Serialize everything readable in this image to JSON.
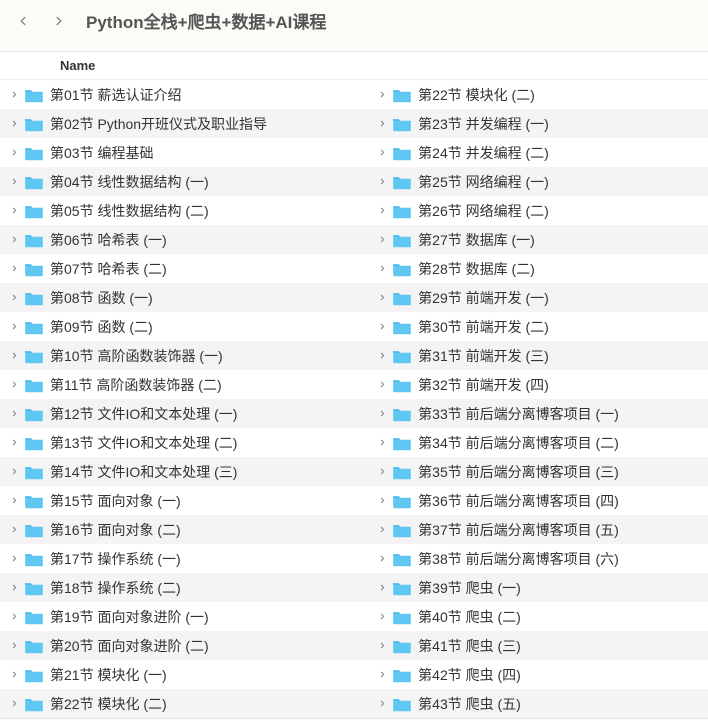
{
  "header": {
    "title": "Python全栈+爬虫+数据+AI课程"
  },
  "column_header": "Name",
  "left_items": [
    "第01节 薪选认证介绍",
    "第02节 Python开班仪式及职业指导",
    "第03节 编程基础",
    "第04节 线性数据结构 (一)",
    "第05节 线性数据结构 (二)",
    "第06节 哈希表 (一)",
    "第07节 哈希表 (二)",
    "第08节 函数 (一)",
    "第09节 函数 (二)",
    "第10节 高阶函数装饰器 (一)",
    "第11节 高阶函数装饰器 (二)",
    "第12节 文件IO和文本处理 (一)",
    "第13节 文件IO和文本处理 (二)",
    "第14节 文件IO和文本处理 (三)",
    "第15节 面向对象 (一)",
    "第16节 面向对象 (二)",
    "第17节 操作系统 (一)",
    "第18节 操作系统 (二)",
    "第19节 面向对象进阶 (一)",
    "第20节 面向对象进阶 (二)",
    "第21节 模块化 (一)",
    "第22节 模块化 (二)"
  ],
  "right_items": [
    "第22节 模块化 (二)",
    "第23节 并发编程 (一)",
    "第24节 并发编程 (二)",
    "第25节 网络编程 (一)",
    "第26节 网络编程 (二)",
    "第27节 数据库 (一)",
    "第28节 数据库 (二)",
    "第29节 前端开发 (一)",
    "第30节 前端开发 (二)",
    "第31节 前端开发 (三)",
    "第32节 前端开发 (四)",
    "第33节 前后端分离博客项目 (一)",
    "第34节 前后端分离博客项目 (二)",
    "第35节 前后端分离博客项目 (三)",
    "第36节 前后端分离博客项目 (四)",
    "第37节 前后端分离博客项目 (五)",
    "第38节 前后端分离博客项目 (六)",
    "第39节 爬虫 (一)",
    "第40节 爬虫 (二)",
    "第41节 爬虫 (三)",
    "第42节 爬虫 (四)",
    "第43节 爬虫 (五)"
  ],
  "colors": {
    "folder_fill": "#5ec8f2",
    "folder_tab": "#4ab8e6"
  }
}
